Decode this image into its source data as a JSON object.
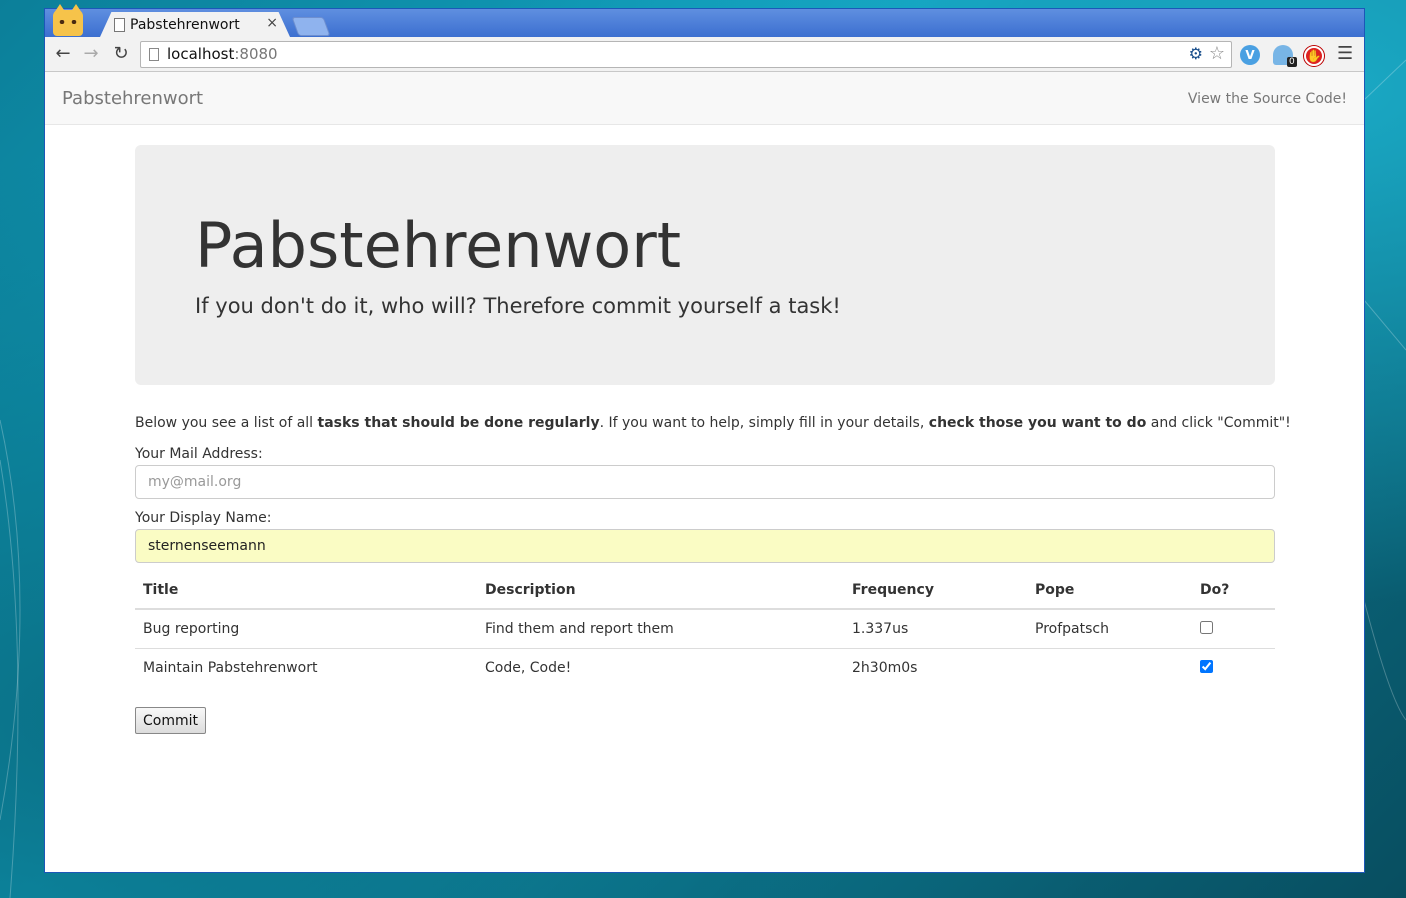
{
  "browser": {
    "tab_title": "Pabstehrenwort",
    "tab_close": "×",
    "url_host": "localhost",
    "url_port": ":8080",
    "extension_badge": "0"
  },
  "navbar": {
    "brand": "Pabstehrenwort",
    "source_link": "View the Source Code!"
  },
  "jumbotron": {
    "title": "Pabstehrenwort",
    "tagline": "If you don't do it, who will? Therefore commit yourself a task!"
  },
  "intro": {
    "part1": "Below you see a list of all ",
    "bold1": "tasks that should be done regularly",
    "part2": ". If you want to help, simply fill in your details, ",
    "bold2": "check those you want to do",
    "part3": " and click \"Commit\"!"
  },
  "form": {
    "mail_label": "Your Mail Address:",
    "mail_placeholder": "my@mail.org",
    "mail_value": "",
    "name_label": "Your Display Name:",
    "name_value": "sternenseemann"
  },
  "table": {
    "headers": [
      "Title",
      "Description",
      "Frequency",
      "Pope",
      "Do?"
    ],
    "rows": [
      {
        "title": "Bug reporting",
        "description": "Find them and report them",
        "frequency": "1.337us",
        "pope": "Profpatsch",
        "checked": false
      },
      {
        "title": "Maintain Pabstehrenwort",
        "description": "Code, Code!",
        "frequency": "2h30m0s",
        "pope": "",
        "checked": true
      }
    ]
  },
  "commit_label": "Commit"
}
